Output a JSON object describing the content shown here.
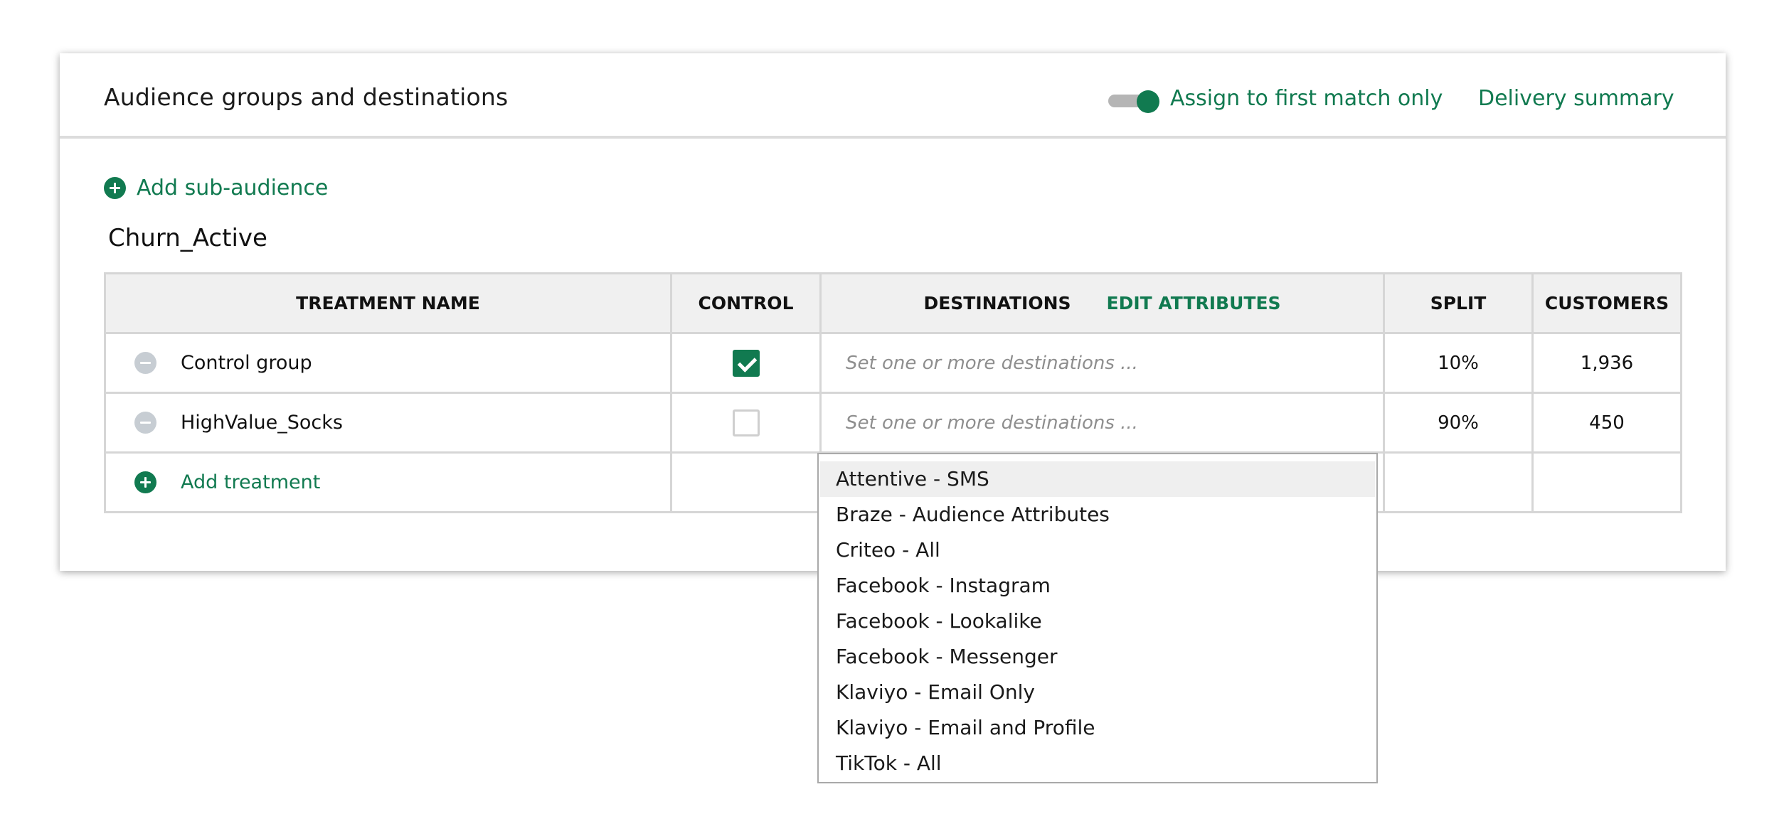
{
  "header": {
    "title": "Audience groups and destinations",
    "toggle_on": true,
    "assign_label": "Assign to first match only",
    "delivery_label": "Delivery summary"
  },
  "add_sub_audience_label": "Add sub-audience",
  "audience_name": "Churn_Active",
  "table": {
    "columns": {
      "treatment_name": "TREATMENT NAME",
      "control": "CONTROL",
      "destinations": "DESTINATIONS",
      "edit_attributes": "EDIT ATTRIBUTES",
      "split": "SPLIT",
      "customers": "CUSTOMERS"
    },
    "rows": [
      {
        "name": "Control group",
        "control": true,
        "destinations_placeholder": "Set one or more destinations ...",
        "split": "10%",
        "customers": "1,936"
      },
      {
        "name": "HighValue_Socks",
        "control": false,
        "destinations_placeholder": "Set one or more destinations ...",
        "split": "90%",
        "customers": "450"
      }
    ],
    "add_treatment_label": "Add treatment"
  },
  "dropdown": {
    "options": [
      "Attentive - SMS",
      "Braze - Audience Attributes",
      "Criteo - All",
      "Facebook - Instagram",
      "Facebook - Lookalike",
      "Facebook - Messenger",
      "Klaviyo - Email Only",
      "Klaviyo - Email and Profile",
      "TikTok - All"
    ],
    "highlighted": "Attentive - SMS"
  },
  "colors": {
    "accent": "#117a50",
    "header_bg": "#f0f0f0",
    "border": "#d6d6d6",
    "remove_icon": "#c7cdd3"
  }
}
